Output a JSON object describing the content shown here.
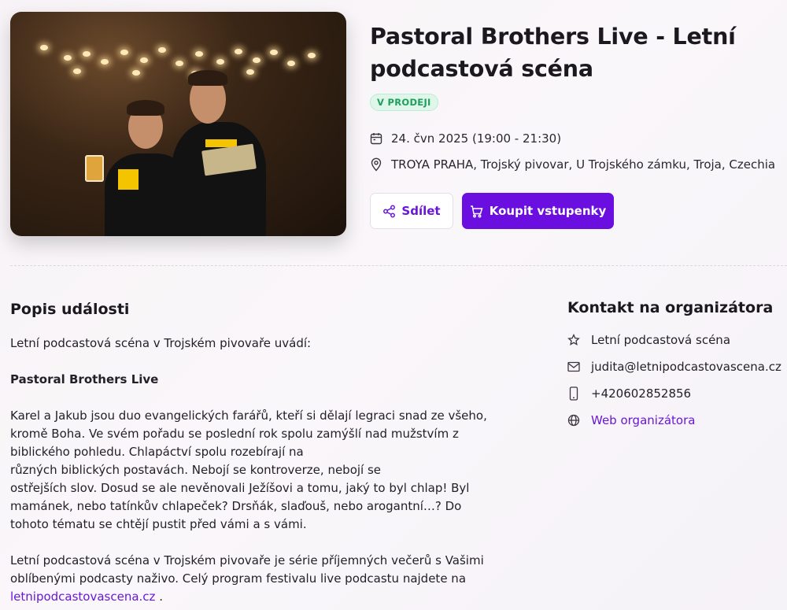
{
  "event": {
    "title": "Pastoral Brothers Live - Letní podcastová scéna",
    "status": "V PRODEJI",
    "date": "24. čvn 2025 (19:00 - 21:30)",
    "location": "TROYA PRAHA, Trojský pivovar, U Trojského zámku, Troja, Czechia",
    "icons": {
      "date": "calendar-icon",
      "location": "map-pin-icon"
    },
    "colors": {
      "accent": "#6b0fe0",
      "status_bg": "#dff7ea",
      "status_text": "#1f9e5c"
    }
  },
  "actions": {
    "share_label": "Sdílet",
    "buy_label": "Koupit vstupenky",
    "share_icon": "share-icon",
    "buy_icon": "cart-icon"
  },
  "description": {
    "heading": "Popis události",
    "intro": "Letní podcastová scéna v Trojském pivovaře uvádí:",
    "show_name": "Pastoral Brothers Live",
    "lines": [
      "Karel a Jakub jsou duo evangelických farářů, kteří si dělají legraci snad ze všeho,",
      "kromě Boha. Ve svém pořadu se poslední rok spolu zamýšlí nad mužstvím z",
      "biblického pohledu. Chlapáctví spolu rozebírají na",
      "různých biblických postavách. Nebojí se kontroverze, nebojí se",
      "ostřejších slov. Dosud se ale nevěnovali Ježíšovi a tomu, jaký to byl chlap! Byl",
      "mamánek, nebo tatínkův chlapeček? Drsňák, slaďouš, nebo arogantní…? Do",
      "tohoto tématu se chtějí pustit před vámi a s vámi."
    ],
    "outro_lines": [
      "Letní podcastová scéna v Trojském pivovaře je série příjemných večerů s Vašimi",
      "oblíbenými podcasty naživo. Celý program festivalu live podcastu najdete na"
    ],
    "link_text": "letnipodcastovascena.cz",
    "link_suffix": " ."
  },
  "contact": {
    "heading": "Kontakt na organizátora",
    "name": "Letní podcastová scéna",
    "email": "judita@letnipodcastovascena.cz",
    "phone": "+420602852856",
    "web_label": "Web organizátora",
    "icons": [
      "star-icon",
      "mail-icon",
      "phone-icon",
      "globe-icon"
    ]
  }
}
